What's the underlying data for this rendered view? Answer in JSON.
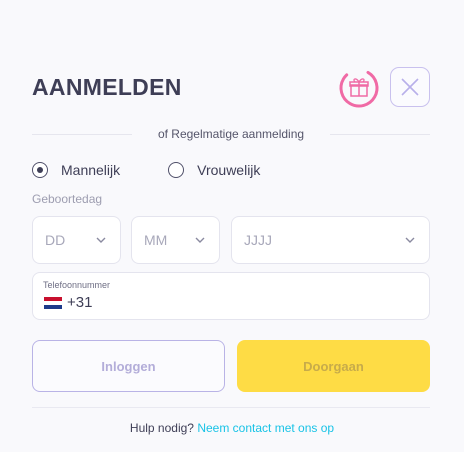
{
  "header": {
    "title": "AANMELDEN",
    "gift_icon": "gift-icon",
    "close_icon": "close-icon"
  },
  "divider": {
    "label": "of Regelmatige aanmelding"
  },
  "gender": {
    "options": [
      {
        "label": "Mannelijk",
        "selected": true
      },
      {
        "label": "Vrouwelijk",
        "selected": false
      }
    ]
  },
  "dob": {
    "label": "Geboortedag",
    "day": "DD",
    "month": "MM",
    "year": "JJJJ"
  },
  "phone": {
    "label": "Telefoonnummer",
    "country_flag": "netherlands-flag-icon",
    "code": "+31"
  },
  "buttons": {
    "login": "Inloggen",
    "continue": "Doorgaan"
  },
  "help": {
    "text": "Hulp nodig?",
    "link": "Neem contact met ons op"
  },
  "colors": {
    "accent_cyan": "#19c3e6",
    "continue_yellow": "#fedc45",
    "login_border": "#b9b3e6",
    "gift_pink": "#f06aa5"
  }
}
